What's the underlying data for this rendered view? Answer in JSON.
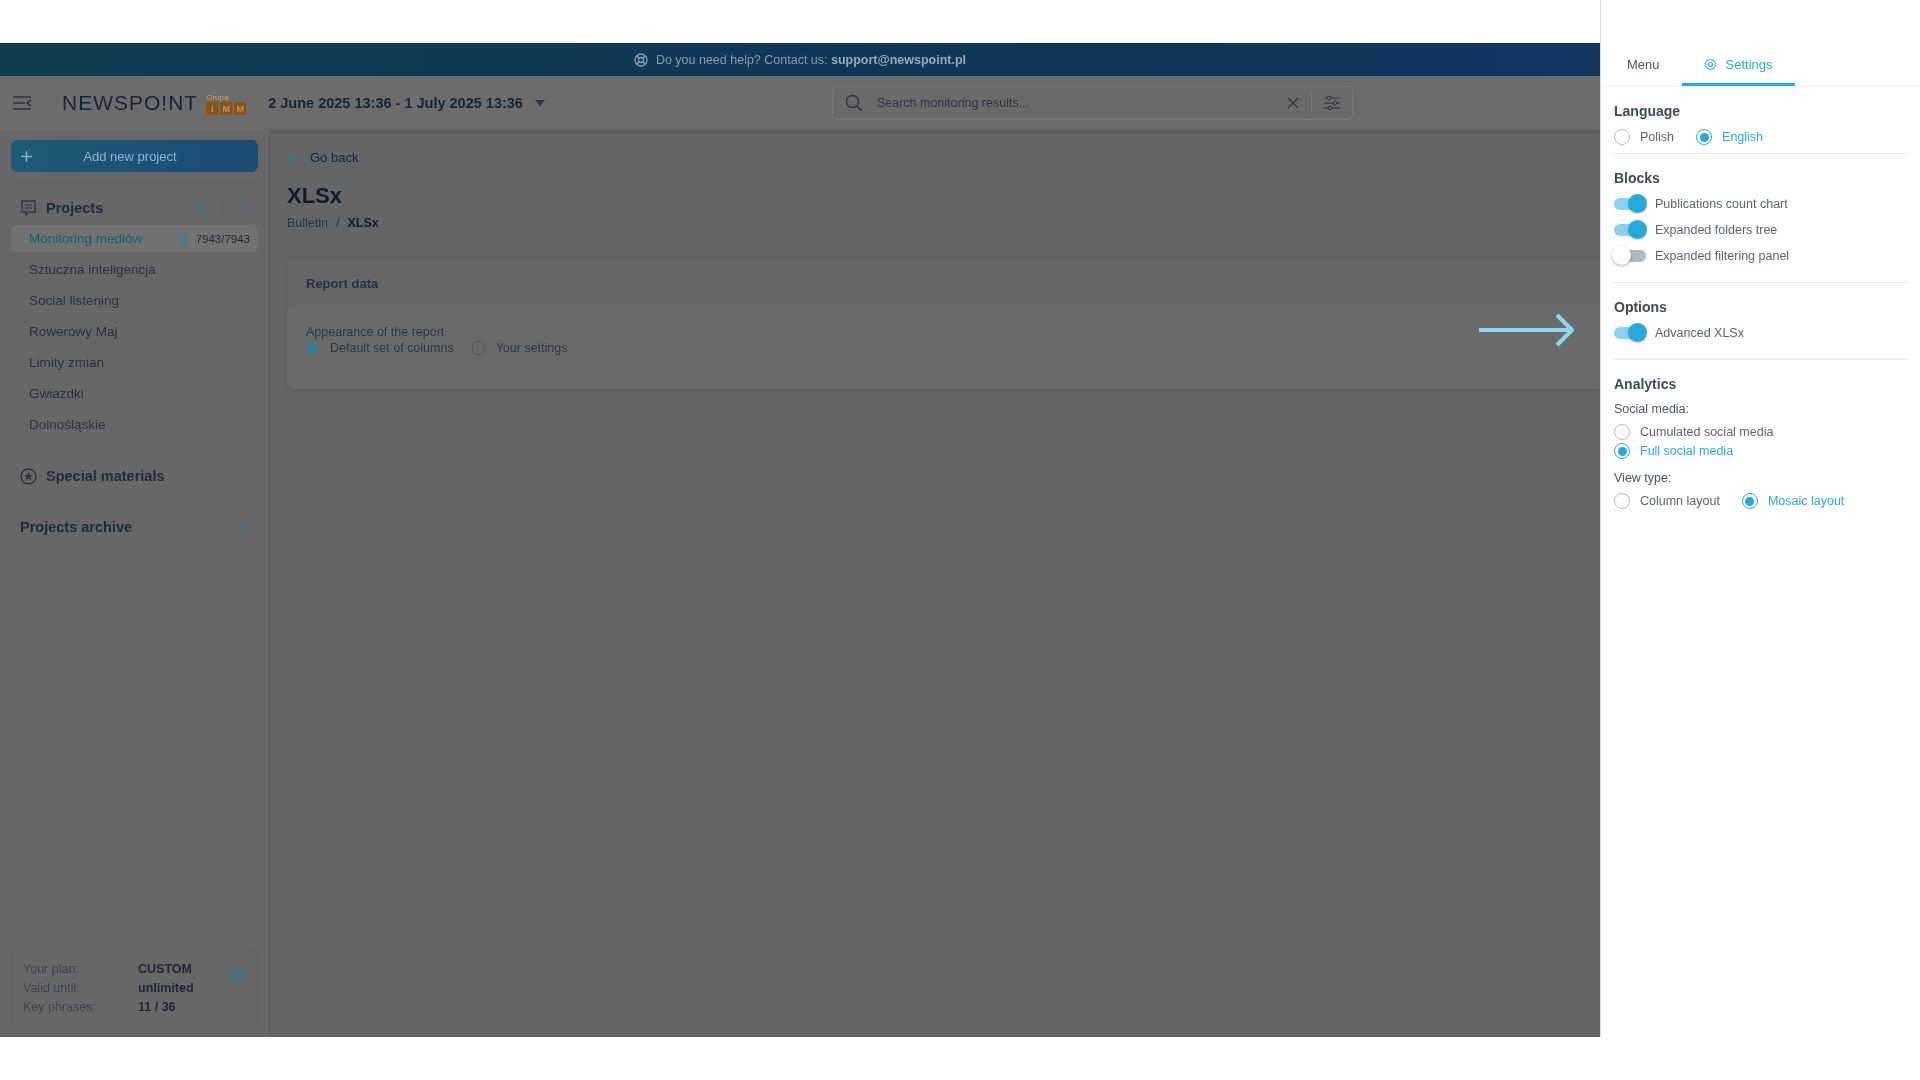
{
  "help_banner": {
    "text": "Do you need help? Contact us: **support@newspoint.pl**"
  },
  "header": {
    "logo": {
      "name": "NEWSPO!NT",
      "group": "Grupa",
      "letters": [
        "I",
        "M",
        "M"
      ]
    },
    "date_range": "2 June 2025 13:36 - 1 July 2025 13:36",
    "search": {
      "placeholder": "Search monitoring results..."
    }
  },
  "sidebar": {
    "add_button": "Add new project",
    "projects": {
      "title": "Projects",
      "expanded": true,
      "items": [
        {
          "label": "Monitoring mediów",
          "selected": true,
          "count": "7943/7943"
        },
        {
          "label": "Sztuczna inteligencja",
          "selected": false
        },
        {
          "label": "Social listening",
          "selected": false
        },
        {
          "label": "Rowerowy Maj",
          "selected": false
        },
        {
          "label": "Limity zmian",
          "selected": false
        },
        {
          "label": "Gwiazdki",
          "selected": false
        },
        {
          "label": "Dolnośląskie",
          "selected": false
        }
      ]
    },
    "special_materials": "Special materials",
    "archive": {
      "title": "Projects archive",
      "expanded": false
    },
    "plan": [
      {
        "label": "Your plan:",
        "value": "CUSTOM"
      },
      {
        "label": "Valid until:",
        "value": "unlimited"
      },
      {
        "label": "Key phrases:",
        "value": "11 / 36"
      }
    ]
  },
  "main": {
    "back": "Go back",
    "title": "XLSx",
    "breadcrumb": {
      "items": [
        "Bulletin",
        "XLSx"
      ],
      "separator": "/"
    },
    "card": {
      "title": "Report data",
      "field_label": "Appearance of the report",
      "options": [
        {
          "label": "Default set of columns",
          "selected": true
        },
        {
          "label": "Your settings",
          "selected": false
        }
      ]
    }
  },
  "panel": {
    "tabs": [
      {
        "label": "Menu",
        "selected": false
      },
      {
        "label": "Settings",
        "selected": true
      }
    ],
    "sections": [
      {
        "title": "Language",
        "kind": "radio",
        "options": [
          {
            "label": "Polish",
            "selected": false
          },
          {
            "label": "English",
            "selected": true
          }
        ]
      },
      {
        "title": "Blocks",
        "kind": "toggle",
        "items": [
          {
            "label": "Publications count chart",
            "on": true
          },
          {
            "label": "Expanded folders tree",
            "on": true
          },
          {
            "label": "Expanded filtering panel",
            "on": false
          }
        ]
      },
      {
        "title": "Options",
        "kind": "toggle",
        "items": [
          {
            "label": "Advanced XLSx",
            "on": true
          }
        ]
      },
      {
        "title": "Analytics",
        "kind": "groups",
        "groups": [
          {
            "label": "Social media:",
            "kind": "column",
            "options": [
              {
                "label": "Cumulated social media",
                "selected": false
              },
              {
                "label": "Full social media",
                "selected": true
              }
            ]
          },
          {
            "label": "View type:",
            "kind": "row",
            "options": [
              {
                "label": "Column layout",
                "selected": false
              },
              {
                "label": "Mosaic layout",
                "selected": true
              }
            ]
          }
        ]
      }
    ]
  }
}
